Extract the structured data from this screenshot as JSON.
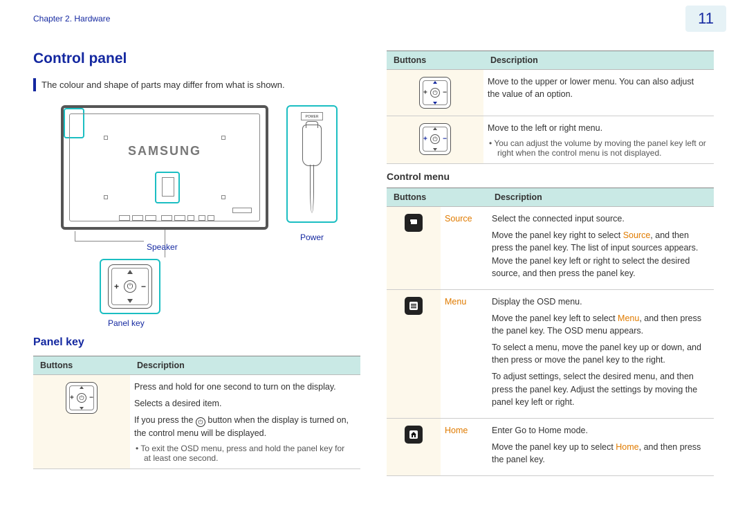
{
  "header": {
    "chapter": "Chapter 2. Hardware",
    "page": "11"
  },
  "section_title": "Control panel",
  "note": "The colour and shape of parts may differ from what is shown.",
  "diagram": {
    "logo": "SAMSUNG",
    "label_power": "Power",
    "label_speaker": "Speaker",
    "label_panelkey": "Panel key",
    "plug_text": "POWER"
  },
  "panel_key": {
    "heading": "Panel key",
    "th_buttons": "Buttons",
    "th_desc": "Description",
    "row1": {
      "p1": "Press and hold for one second to turn on the display.",
      "p2": "Selects a desired item.",
      "p3a": "If you press the ",
      "p3b": " button when the display is turned on, the control menu will be displayed.",
      "bullet": "To exit the OSD menu, press and hold the panel key for at least one second."
    }
  },
  "right_table": {
    "th_buttons": "Buttons",
    "th_desc": "Description",
    "row_ud": "Move to the upper or lower menu. You can also adjust the value of an option.",
    "row_lr": {
      "p1": "Move to the left or right menu.",
      "bullet": "You can adjust the volume by moving the panel key left or right when the control menu is not displayed."
    }
  },
  "control_menu": {
    "heading": "Control menu",
    "th_buttons": "Buttons",
    "th_desc": "Description",
    "source": {
      "name": "Source",
      "p1": "Select the connected input source.",
      "p2a": "Move the panel key right to select ",
      "p2b": ", and then press the panel key. The list of input sources appears. Move the panel key left or right to select the desired source, and then press the panel key."
    },
    "menu": {
      "name": "Menu",
      "p1": "Display the OSD menu.",
      "p2a": "Move the panel key left to select ",
      "p2b": ", and then press the panel key. The OSD menu appears.",
      "p3": "To select a menu, move the panel key up or down, and then press or move the panel key to the right.",
      "p4": "To adjust settings, select the desired menu, and then press the panel key. Adjust the settings by moving the panel key left or right."
    },
    "home": {
      "name": "Home",
      "p1": "Enter Go to Home mode.",
      "p2a": "Move the panel key up to select ",
      "p2b": ", and then press the panel key."
    }
  }
}
